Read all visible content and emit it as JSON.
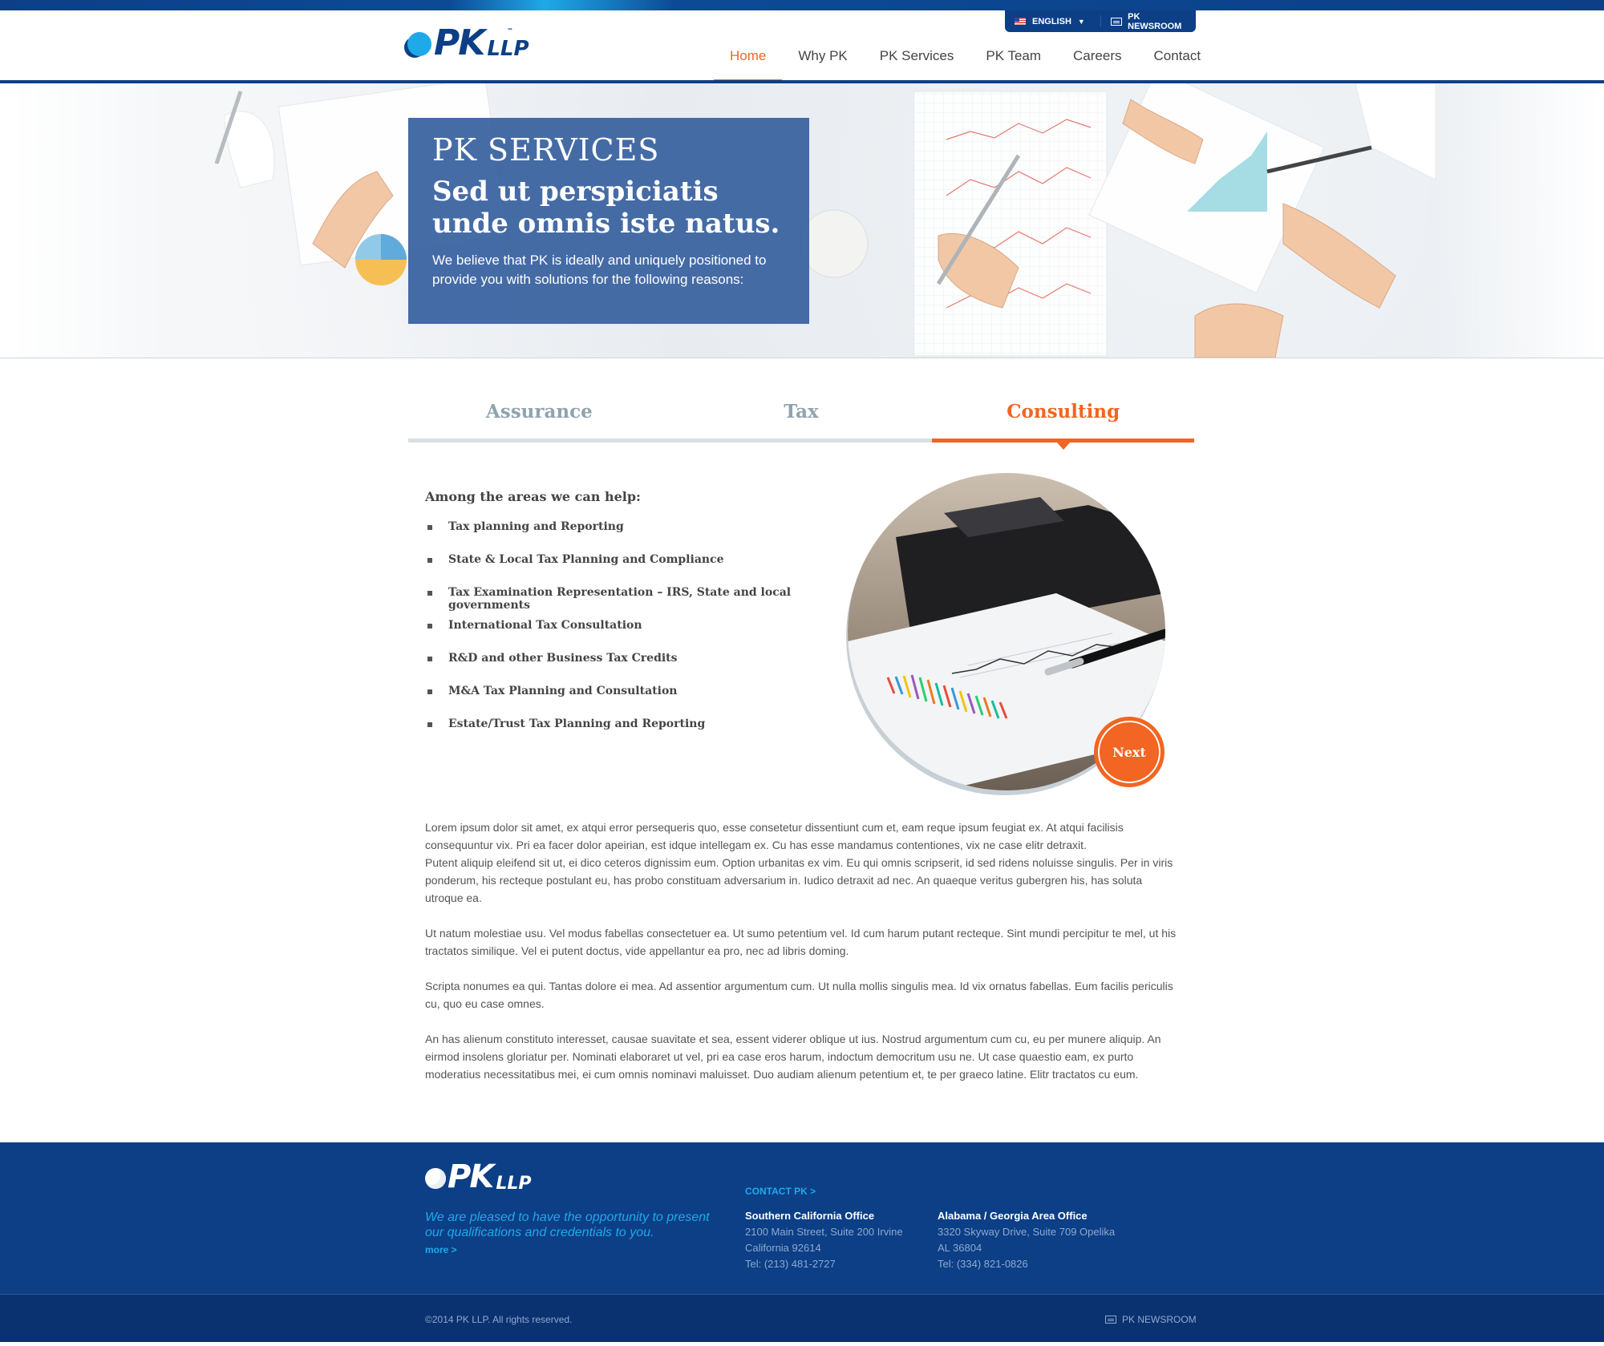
{
  "header": {
    "language_label": "ENGLISH",
    "newsroom_label": "PK NEWSROOM",
    "logo": {
      "mark": "PK",
      "suffix": "LLP",
      "tm": "™"
    },
    "nav": [
      "Home",
      "Why PK",
      "PK Services",
      "PK Team",
      "Careers",
      "Contact"
    ],
    "active_nav": "Home"
  },
  "hero": {
    "eyebrow": "PK SERVICES",
    "headline": "Sed ut perspiciatis unde omnis iste natus.",
    "intro": "We believe that PK is ideally and uniquely positioned to provide you with solutions for the following reasons:"
  },
  "tabs": [
    "Assurance",
    "Tax",
    "Consulting"
  ],
  "active_tab": "Consulting",
  "areas": {
    "heading": "Among the areas we can help:",
    "items": [
      "Tax planning and Reporting",
      "State & Local Tax Planning and Compliance",
      "Tax Examination Representation – IRS, State and local governments",
      "International Tax Consultation",
      "R&D and other Business Tax Credits",
      "M&A Tax Planning and Consultation",
      "Estate/Trust Tax Planning and Reporting"
    ]
  },
  "next_label": "Next",
  "body_paragraphs": [
    "Lorem ipsum dolor sit amet, ex atqui error persequeris quo, esse consetetur dissentiunt cum et, eam reque ipsum feugiat ex. At atqui facilisis consequuntur vix. Pri ea facer dolor apeirian, est idque intellegam ex. Cu has esse mandamus contentiones, vix ne case elitr detraxit.\nPutent aliquip eleifend sit ut, ei dico ceteros dignissim eum. Option urbanitas ex vim. Eu qui omnis scripserit, id sed ridens noluisse singulis. Per in viris ponderum, his recteque postulant eu, has probo constituam adversarium in. Iudico detraxit ad nec. An quaeque veritus gubergren his, has soluta utroque ea.",
    "Ut natum molestiae usu. Vel modus fabellas consectetuer ea. Ut sumo petentium vel. Id cum harum putant recteque. Sint mundi percipitur te mel, ut his tractatos similique. Vel ei putent doctus, vide appellantur ea pro, nec ad libris doming.",
    "Scripta nonumes ea qui. Tantas dolore ei mea. Ad assentior argumentum cum. Ut nulla mollis singulis mea. Id vix ornatus fabellas. Eum facilis periculis cu, quo eu case omnes.",
    "An has alienum constituto interesset, causae suavitate et sea, essent viderer oblique ut ius. Nostrud argumentum cum cu, eu per munere aliquip. An eirmod insolens gloriatur per. Nominati elaboraret ut vel, pri ea case eros harum, indoctum democritum usu ne. Ut case quaestio eam, ex purto moderatius necessitatibus mei, ei cum omnis nominavi maluisset. Duo audiam alienum petentium et, te per graeco latine. Elitr tractatos cu eum."
  ],
  "footer": {
    "logo": {
      "mark": "PK",
      "suffix": "LLP"
    },
    "tagline": "We are pleased to have the opportunity to present our qualifications and credentials to you.",
    "more_label": "more >",
    "contact_label": "CONTACT PK >",
    "offices": [
      {
        "name": "Southern California Office",
        "lines": [
          "2100 Main Street, Suite 200 Irvine",
          "California 92614",
          "Tel: (213) 481-2727"
        ]
      },
      {
        "name": "Alabama / Georgia Area Office",
        "lines": [
          "3320 Skyway Drive, Suite 709 Opelika",
          "AL 36804",
          "Tel: (334) 821-0826"
        ]
      }
    ],
    "copyright": "©2014 PK LLP. All rights reserved.",
    "newsroom_label": "PK NEWSROOM"
  },
  "colors": {
    "primary": "#0c3f86",
    "accent": "#f26522",
    "link": "#1fa9e8"
  }
}
